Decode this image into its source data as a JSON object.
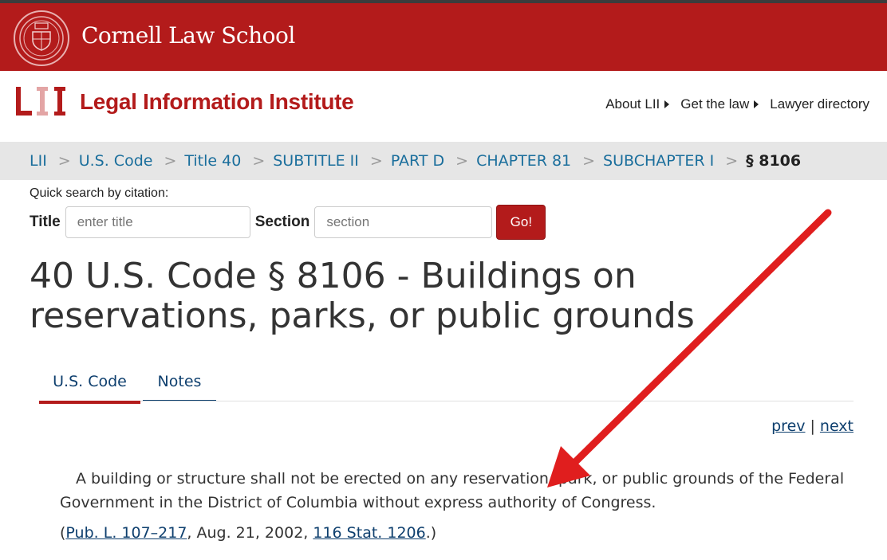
{
  "header": {
    "cornell_name": "Cornell Law School",
    "lii_name": "Legal Information Institute",
    "nav": [
      {
        "label": "About LII"
      },
      {
        "label": "Get the law"
      },
      {
        "label": "Lawyer directory"
      }
    ]
  },
  "breadcrumb": {
    "items": [
      {
        "label": "LII"
      },
      {
        "label": "U.S. Code"
      },
      {
        "label": "Title 40"
      },
      {
        "label": "SUBTITLE II"
      },
      {
        "label": "PART D"
      },
      {
        "label": "CHAPTER 81"
      },
      {
        "label": "SUBCHAPTER I"
      }
    ],
    "separator": ">",
    "current": "§ 8106"
  },
  "quick_search": {
    "label": "Quick search by citation:",
    "title_label": "Title",
    "title_placeholder": "enter title",
    "section_label": "Section",
    "section_placeholder": "section",
    "go_label": "Go!"
  },
  "page": {
    "title": "40 U.S. Code § 8106 - Buildings on reservations, parks, or public grounds"
  },
  "tabs": [
    {
      "label": "U.S. Code",
      "active": true
    },
    {
      "label": "Notes",
      "active": false
    }
  ],
  "pager": {
    "prev": "prev",
    "divider": "|",
    "next": "next"
  },
  "content": {
    "paragraph": "A building or structure shall not be erected on any reservation, park, or public grounds of the Federal Government in the District of Columbia without express authority of Congress.",
    "source": {
      "open": "(",
      "pub_law": "Pub. L. 107–217",
      "mid": ", Aug. 21, 2002, ",
      "stat": "116 Stat. 1206",
      "close": ".)"
    }
  },
  "colors": {
    "cornell_red": "#b31b1b",
    "link_blue": "#1a6e9c",
    "tab_blue": "#0e3f6e",
    "breadcrumb_bg": "#e6e6e6",
    "annotation_arrow": "#e01e1e"
  },
  "icons": {
    "seal": "cornell-seal-icon",
    "lii_logo": "lii-logo-icon",
    "nav_caret": "caret-right-icon",
    "annotation": "red-arrow-icon"
  }
}
